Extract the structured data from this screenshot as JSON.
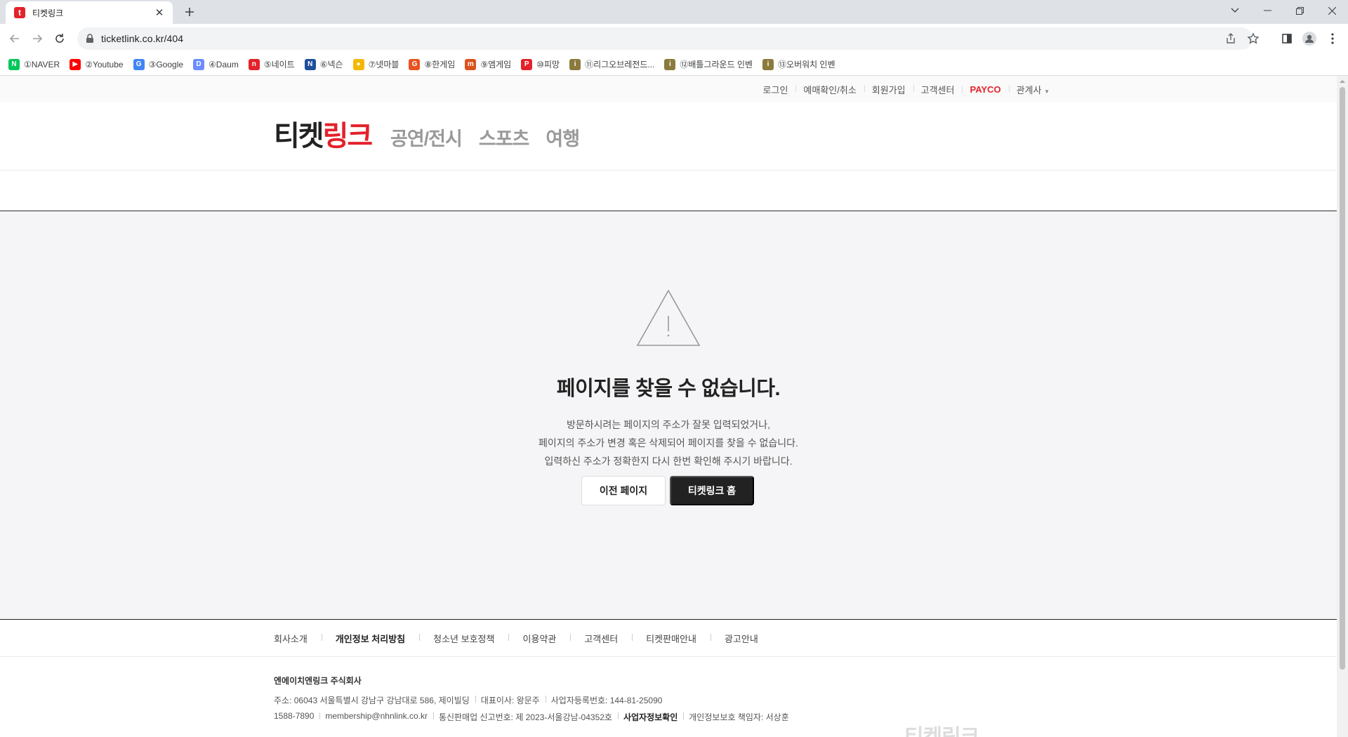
{
  "browser": {
    "tab_title": "티켓링크",
    "url": "ticketlink.co.kr/404",
    "bookmarks": [
      {
        "label": "①NAVER",
        "icon": "naver-icon",
        "color": "#03c75a",
        "glyph": "N"
      },
      {
        "label": "②Youtube",
        "icon": "youtube-icon",
        "color": "#ff0000",
        "glyph": "▶"
      },
      {
        "label": "③Google",
        "icon": "google-icon",
        "color": "#4285f4",
        "glyph": "G"
      },
      {
        "label": "④Daum",
        "icon": "daum-icon",
        "color": "#6c8cff",
        "glyph": "D"
      },
      {
        "label": "⑤네이트",
        "icon": "nate-icon",
        "color": "#e3222b",
        "glyph": "n"
      },
      {
        "label": "⑥넥슨",
        "icon": "nexon-icon",
        "color": "#1d4f9c",
        "glyph": "N"
      },
      {
        "label": "⑦넷마블",
        "icon": "netmarble-icon",
        "color": "#f5b800",
        "glyph": "●"
      },
      {
        "label": "⑧한게임",
        "icon": "hangame-icon",
        "color": "#e8531f",
        "glyph": "G"
      },
      {
        "label": "⑨엠게임",
        "icon": "mgame-icon",
        "color": "#d9531e",
        "glyph": "m"
      },
      {
        "label": "⑩피망",
        "icon": "pmang-icon",
        "color": "#e3222b",
        "glyph": "P"
      },
      {
        "label": "⑪리그오브레전드...",
        "icon": "lol-icon",
        "color": "#8a7a3c",
        "glyph": "i"
      },
      {
        "label": "⑫배틀그라운드 인벤",
        "icon": "inven-icon",
        "color": "#8a7a3c",
        "glyph": "i"
      },
      {
        "label": "⑬오버워치 인벤",
        "icon": "inven-icon",
        "color": "#8a7a3c",
        "glyph": "i"
      }
    ]
  },
  "util_nav": {
    "links": [
      "로그인",
      "예매확인/취소",
      "회원가입",
      "고객센터",
      "PAYCO",
      "관계사"
    ]
  },
  "header": {
    "logo_dark": "티켓",
    "logo_red": "링크",
    "menu": [
      "공연/전시",
      "스포츠",
      "여행"
    ]
  },
  "error": {
    "title": "페이지를 찾을 수 없습니다.",
    "desc_line1": "방문하시려는 페이지의 주소가 잘못 입력되었거나,",
    "desc_line2": "페이지의 주소가 변경 혹은 삭제되어 페이지를 찾을 수 없습니다.",
    "desc_line3": "입력하신 주소가 정확한지 다시 한번 확인해 주시기 바랍니다.",
    "btn_prev": "이전 페이지",
    "btn_home": "티켓링크 홈"
  },
  "footer": {
    "links": [
      "회사소개",
      "개인정보 처리방침",
      "청소년 보호정책",
      "이용약관",
      "고객센터",
      "티켓판매안내",
      "광고안내"
    ],
    "company": "엔에이치엔링크 주식회사",
    "address": "주소: 06043 서울특별시 강남구 강남대로 586, 제이빌딩",
    "ceo": "대표이사: 왕문주",
    "biz_no": "사업자등록번호: 144-81-25090",
    "phone": "1588-7890",
    "email": "membership@nhnlink.co.kr",
    "mail_order": "통신판매업 신고번호: 제 2023-서울강남-04352호",
    "biz_info": "사업자정보확인",
    "privacy_officer": "개인정보보호 책임자: 서상훈",
    "logo_text": "티켓링크"
  },
  "colors": {
    "brand_red": "#e3222b",
    "dark": "#222222",
    "content_bg": "#f5f5f7"
  }
}
